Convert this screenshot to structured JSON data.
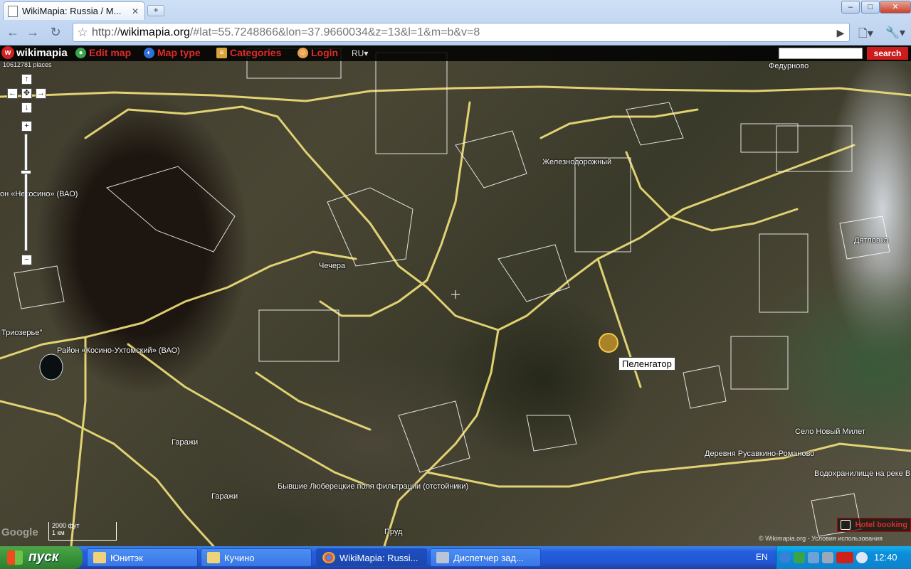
{
  "browser": {
    "tab_title": "WikiMapia: Russia / M...",
    "tab_close": "✕",
    "new_tab": "+",
    "url_prefix": "http://",
    "url_host": "wikimapia.org",
    "url_rest": "/#lat=55.7248866&lon=37.9660034&z=13&l=1&m=b&v=8"
  },
  "wikimapia": {
    "logo": "wikimapia",
    "places_count": "10612781 places",
    "menu": {
      "edit_map": "Edit map",
      "map_type": "Map type",
      "categories": "Categories",
      "login": "Login"
    },
    "language": "RU",
    "search_button": "search"
  },
  "map": {
    "labels": {
      "fedurnovo": "Федурново",
      "zheleznodorozhny": "Железнодорожный",
      "nekrasovka": "он «Некосино» (ВАО)",
      "dyatlovka": "Дятловка",
      "chechera": "Чечера",
      "triozerye": "Триозерье\"",
      "kosino": "Район «Косино-Ухтомский» (ВАО)",
      "selo_novy_milet": "Село Новый Милет",
      "derevnya": "Деревня Русавкино-Романово",
      "vodokhranilische": "Водохранилище на реке Вь",
      "garazhi_1": "Гаражи",
      "garazhi_2": "Гаражи",
      "polya": "Бывшие Люберецкие поля фильтрации (отстойники)",
      "prud": "Пруд"
    },
    "tooltip": "Пеленгатор",
    "scale_top": "2000 фут",
    "scale_bottom": "1 км",
    "google": "Google",
    "hotel_booking": "Hotel booking",
    "copyright": "© Wikimapia.org - Условия использования"
  },
  "taskbar": {
    "start": "пуск",
    "tasks": [
      {
        "label": "Юнитэк"
      },
      {
        "label": "Кучино"
      },
      {
        "label": "WikiMapia: Russi..."
      },
      {
        "label": "Диспетчер зад..."
      }
    ],
    "lang": "EN",
    "clock": "12:40"
  },
  "colors": {
    "accent_red": "#e02a2a",
    "road_yellow": "#f2e27a",
    "outline_white": "#ffffff",
    "taskbar_blue": "#245edb",
    "start_green": "#37933a"
  }
}
